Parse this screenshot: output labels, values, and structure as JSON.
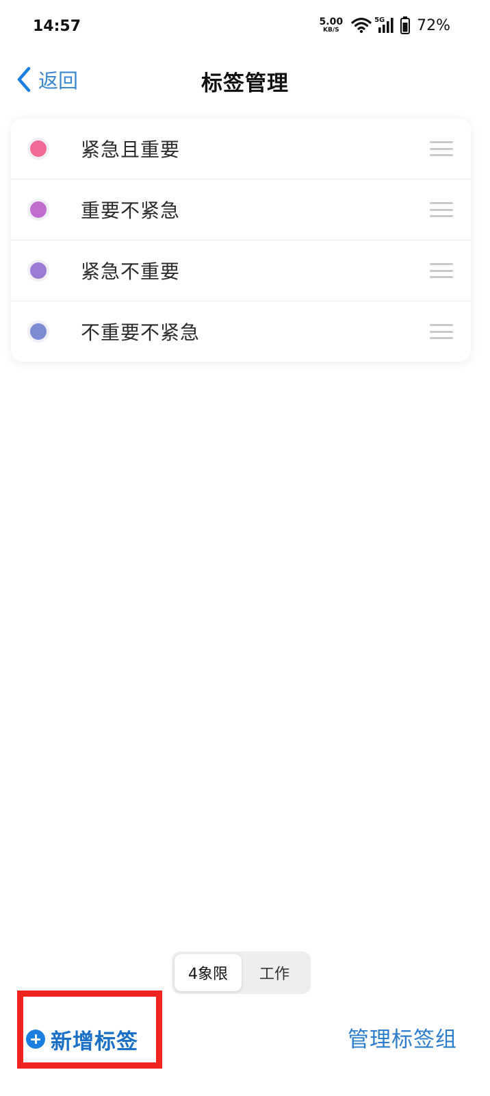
{
  "status_bar": {
    "time": "14:57",
    "net_speed_value": "5.00",
    "net_speed_unit": "KB/S",
    "signal_label": "5G",
    "battery": "72%"
  },
  "header": {
    "back_label": "返回",
    "title": "标签管理"
  },
  "tags": [
    {
      "label": "紧急且重要",
      "color": "#ef6a94"
    },
    {
      "label": "重要不紧急",
      "color": "#c06dd0"
    },
    {
      "label": "紧急不重要",
      "color": "#9b7bd6"
    },
    {
      "label": "不重要不紧急",
      "color": "#7e8bd3"
    }
  ],
  "segment": {
    "active": "4象限",
    "inactive": "工作"
  },
  "bottom": {
    "add_tag_label": "新增标签",
    "manage_group_label": "管理标签组"
  },
  "colors": {
    "accent": "#1a7fe0",
    "highlight": "#f0241e"
  }
}
